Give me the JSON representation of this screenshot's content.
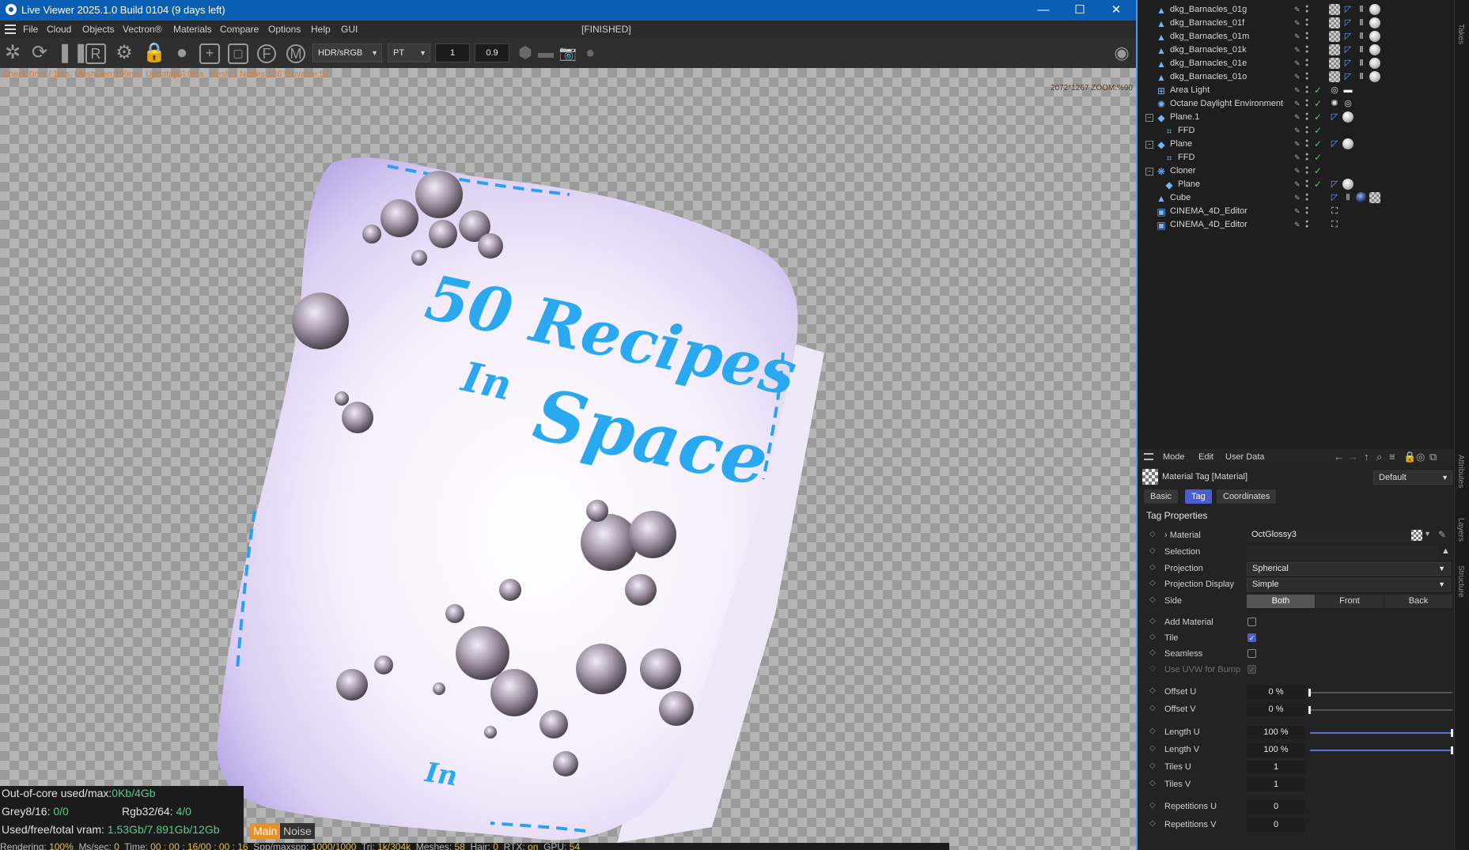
{
  "window": {
    "title": "Live Viewer 2025.1.0 Build 0104 (9 days left)",
    "controls": {
      "minimize": "—",
      "maximize": "☐",
      "close": "✕"
    },
    "menu": [
      "File",
      "Cloud",
      "Objects",
      "Vectron®",
      "Materials",
      "Compare",
      "Options",
      "Help",
      "GUI"
    ],
    "status": "[FINISHED]"
  },
  "toolbar": {
    "colorspace": "HDR/sRGB",
    "kernel": "PT",
    "value1": "1",
    "value2": "0.9"
  },
  "viewport": {
    "stats": "Check:0ms / 1ms. MeshGen:199ms. Update[G]:0ms. Mesh:1 Nodes:136 Movable:57",
    "zoom": "2072*1267 ZOOM:%90",
    "render_text": {
      "line1": "50 Recipes",
      "line2": "In",
      "line3": "Space",
      "line4": "In"
    },
    "info": {
      "ooc_label": "Out-of-core used/max:",
      "ooc_value": "0Kb/4Gb",
      "grey_label": "Grey8/16:",
      "grey_value": "0/0",
      "rgb_label": "Rgb32/64:",
      "rgb_value": "4/0",
      "vram_label": "Used/free/total vram:",
      "vram_value": "1.53Gb/7.891Gb/12Gb"
    },
    "channel_main": "Main",
    "channel_noise": "Noise",
    "bottom": {
      "rendering_label": "Rendering:",
      "rendering_value": "100%",
      "ms_label": "Ms/sec:",
      "ms_value": "0",
      "time_label": "Time:",
      "time_value": "00 : 00 : 16/00 : 00 : 16",
      "spp_label": "Spp/maxspp:",
      "spp_value": "1000/1000",
      "tri_label": "Tri:",
      "tri_value": "1k/304k",
      "meshes_label": "Meshes:",
      "meshes_value": "58",
      "hair_label": "Hair:",
      "hair_value": "0",
      "rtx_label": "RTX:",
      "rtx_value": "on",
      "gpu_label": "GPU:",
      "gpu_value": "54"
    }
  },
  "objects": [
    {
      "name": "dkg_Barnacles_01g",
      "icon": "polygon-object-icon",
      "indent": 0,
      "tags": [
        "mat",
        "ph",
        "sym",
        "sph"
      ]
    },
    {
      "name": "dkg_Barnacles_01f",
      "icon": "polygon-object-icon",
      "indent": 0,
      "tags": [
        "mat",
        "ph",
        "sym",
        "sph"
      ]
    },
    {
      "name": "dkg_Barnacles_01m",
      "icon": "polygon-object-icon",
      "indent": 0,
      "tags": [
        "mat",
        "ph",
        "sym",
        "sph"
      ]
    },
    {
      "name": "dkg_Barnacles_01k",
      "icon": "polygon-object-icon",
      "indent": 0,
      "tags": [
        "mat",
        "ph",
        "sym",
        "sph"
      ]
    },
    {
      "name": "dkg_Barnacles_01e",
      "icon": "polygon-object-icon",
      "indent": 0,
      "tags": [
        "mat",
        "ph",
        "sym",
        "sph"
      ]
    },
    {
      "name": "dkg_Barnacles_01o",
      "icon": "polygon-object-icon",
      "indent": 0,
      "tags": [
        "mat",
        "ph",
        "sym",
        "sph"
      ]
    },
    {
      "name": "Area Light",
      "icon": "light-icon",
      "indent": 0,
      "check": true,
      "tags": [
        "target",
        "rect"
      ]
    },
    {
      "name": "Octane Daylight Environment",
      "icon": "sun-icon",
      "indent": 0,
      "check": true,
      "tags": [
        "sun",
        "target"
      ]
    },
    {
      "name": "Plane.1",
      "icon": "plane-icon",
      "indent": 0,
      "expand": "−",
      "check": true,
      "tags": [
        "ph",
        "sph"
      ]
    },
    {
      "name": "FFD",
      "icon": "ffd-icon",
      "indent": 1,
      "check": true,
      "tags": []
    },
    {
      "name": "Plane",
      "icon": "plane-icon",
      "indent": 0,
      "expand": "−",
      "check": true,
      "tags": [
        "ph",
        "sph"
      ]
    },
    {
      "name": "FFD",
      "icon": "ffd-icon",
      "indent": 1,
      "check": true,
      "tags": []
    },
    {
      "name": "Cloner",
      "icon": "cloner-icon",
      "indent": 0,
      "expand": "−",
      "check": true,
      "tags": []
    },
    {
      "name": "Plane",
      "icon": "plane-icon",
      "indent": 1,
      "check": true,
      "tags": [
        "ph",
        "sph"
      ]
    },
    {
      "name": "Cube",
      "icon": "polygon-object-icon",
      "indent": 0,
      "tags": [
        "ph",
        "sym",
        "dark",
        "mat"
      ]
    },
    {
      "name": "CINEMA_4D_Editor",
      "icon": "camera-icon",
      "indent": 0,
      "tags": [
        "frame"
      ]
    },
    {
      "name": "CINEMA_4D_Editor",
      "icon": "camera-icon",
      "indent": 0,
      "tags": [
        "frame"
      ]
    }
  ],
  "side_tabs": [
    "Takes",
    "Attributes",
    "Layers",
    "Structure"
  ],
  "attributes": {
    "menu": [
      "Mode",
      "Edit",
      "User Data"
    ],
    "object_title": "Material Tag [Material]",
    "preset": "Default",
    "tabs": [
      "Basic",
      "Tag",
      "Coordinates"
    ],
    "active_tab": "Tag",
    "section": "Tag Properties",
    "material_label": "Material",
    "material_value": "OctGlossy3",
    "selection_label": "Selection",
    "selection_value": "",
    "projection_label": "Projection",
    "projection_value": "Spherical",
    "projection_display_label": "Projection Display",
    "projection_display_value": "Simple",
    "side_label": "Side",
    "side_options": [
      "Both",
      "Front",
      "Back"
    ],
    "side_active": "Both",
    "add_material_label": "Add Material",
    "add_material": false,
    "tile_label": "Tile",
    "tile": true,
    "seamless_label": "Seamless",
    "seamless": false,
    "use_uvw_label": "Use UVW for Bump",
    "use_uvw": true,
    "offset_u_label": "Offset U",
    "offset_u": "0 %",
    "offset_u_frac": 0.0,
    "offset_v_label": "Offset V",
    "offset_v": "0 %",
    "offset_v_frac": 0.0,
    "length_u_label": "Length U",
    "length_u": "100 %",
    "length_u_frac": 1.0,
    "length_v_label": "Length V",
    "length_v": "100 %",
    "length_v_frac": 1.0,
    "tiles_u_label": "Tiles U",
    "tiles_u": "1",
    "tiles_v_label": "Tiles V",
    "tiles_v": "1",
    "repetitions_u_label": "Repetitions U",
    "repetitions_u": "0",
    "repetitions_v_label": "Repetitions V",
    "repetitions_v": "0"
  }
}
